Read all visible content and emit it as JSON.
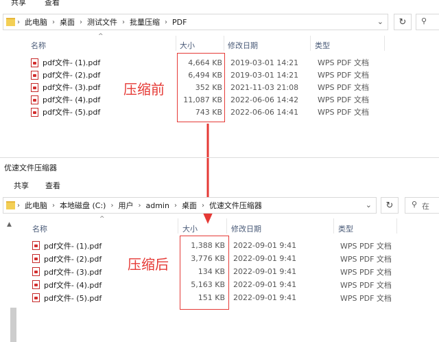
{
  "top": {
    "ribbon": {
      "share": "共享",
      "view": "查看"
    },
    "breadcrumb": [
      "此电脑",
      "桌面",
      "测试文件",
      "批量压缩",
      "PDF"
    ],
    "columns": {
      "name": "名称",
      "size": "大小",
      "date": "修改日期",
      "type": "类型"
    },
    "files": [
      {
        "name": "pdf文件- (1).pdf",
        "size": "4,664 KB",
        "date": "2019-03-01 14:21",
        "type": "WPS PDF 文档"
      },
      {
        "name": "pdf文件- (2).pdf",
        "size": "6,494 KB",
        "date": "2019-03-01 14:21",
        "type": "WPS PDF 文档"
      },
      {
        "name": "pdf文件- (3).pdf",
        "size": "352 KB",
        "date": "2021-11-03 21:08",
        "type": "WPS PDF 文档"
      },
      {
        "name": "pdf文件- (4).pdf",
        "size": "11,087 KB",
        "date": "2022-06-06 14:42",
        "type": "WPS PDF 文档"
      },
      {
        "name": "pdf文件- (5).pdf",
        "size": "743 KB",
        "date": "2022-06-06 14:41",
        "type": "WPS PDF 文档"
      }
    ],
    "annotation": "压缩前"
  },
  "bottom": {
    "window_title": "优速文件压缩器",
    "ribbon": {
      "share": "共享",
      "view": "查看"
    },
    "breadcrumb": [
      "此电脑",
      "本地磁盘 (C:)",
      "用户",
      "admin",
      "桌面",
      "优速文件压缩器"
    ],
    "search_text": "在",
    "columns": {
      "name": "名称",
      "size": "大小",
      "date": "修改日期",
      "type": "类型"
    },
    "files": [
      {
        "name": "pdf文件- (1).pdf",
        "size": "1,388 KB",
        "date": "2022-09-01 9:41",
        "type": "WPS PDF 文档"
      },
      {
        "name": "pdf文件- (2).pdf",
        "size": "3,776 KB",
        "date": "2022-09-01 9:41",
        "type": "WPS PDF 文档"
      },
      {
        "name": "pdf文件- (3).pdf",
        "size": "134 KB",
        "date": "2022-09-01 9:41",
        "type": "WPS PDF 文档"
      },
      {
        "name": "pdf文件- (4).pdf",
        "size": "5,163 KB",
        "date": "2022-09-01 9:41",
        "type": "WPS PDF 文档"
      },
      {
        "name": "pdf文件- (5).pdf",
        "size": "151 KB",
        "date": "2022-09-01 9:41",
        "type": "WPS PDF 文档"
      }
    ],
    "annotation": "压缩后"
  },
  "colors": {
    "annotation_red": "#e53935",
    "folder_yellow": "#f3cf55"
  }
}
